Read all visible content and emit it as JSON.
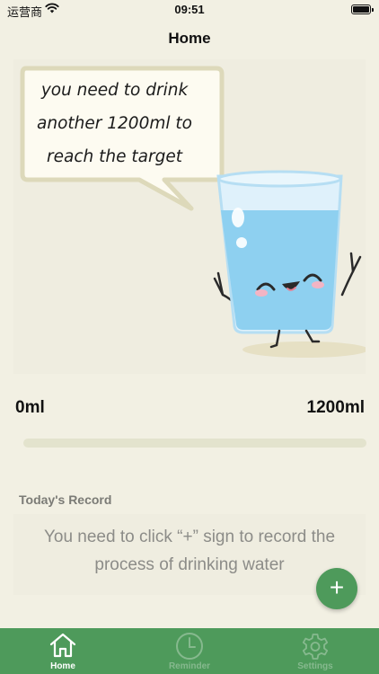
{
  "status_bar": {
    "carrier": "运营商",
    "time": "09:51"
  },
  "nav": {
    "title": "Home"
  },
  "hero": {
    "message": "you need to drink another 1200ml to reach the target"
  },
  "progress": {
    "min_label": "0ml",
    "max_label": "1200ml",
    "fraction": 0.0
  },
  "record": {
    "title": "Today's Record",
    "empty_text": "You need to click “+” sign to record the process of drinking water"
  },
  "fab": {
    "label": "+"
  },
  "tabs": [
    {
      "label": "Home",
      "icon": "home-icon"
    },
    {
      "label": "Reminder",
      "icon": "clock-icon"
    },
    {
      "label": "Settings",
      "icon": "gear-icon"
    }
  ],
  "colors": {
    "accent": "#4e9a5b",
    "background": "#f2f0e3",
    "card": "#efede0"
  }
}
